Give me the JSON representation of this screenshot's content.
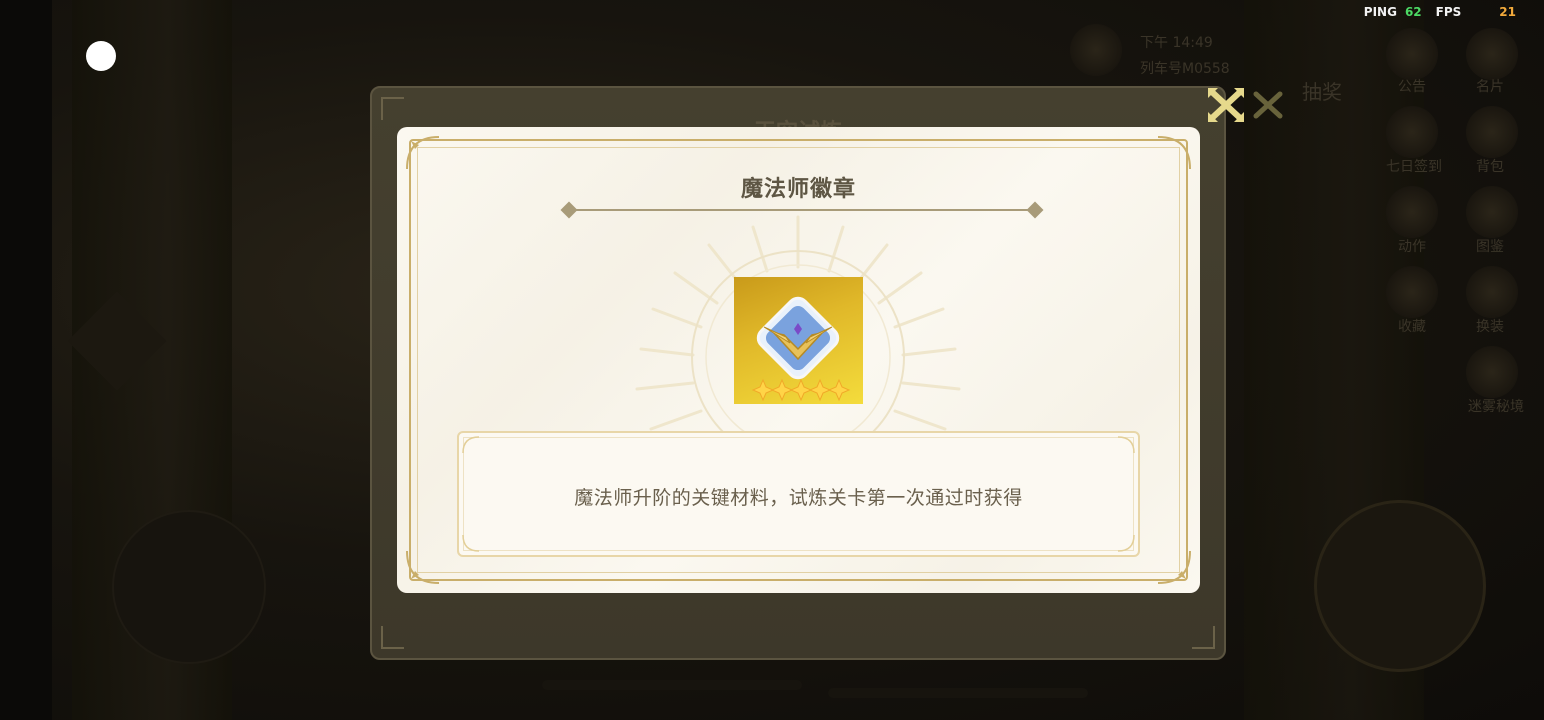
{
  "status_bar": {
    "ping_label": "PING",
    "ping_value": "62",
    "fps_label": "FPS",
    "fps_value": "21",
    "ping_color": "#4cd964",
    "fps_color": "#f2a93b"
  },
  "background": {
    "time_text": "下午 14:49",
    "sub_text": "列车号M0558",
    "lottery_label": "抽奖",
    "side_menu": [
      "公告",
      "名片",
      "七日签到",
      "背包",
      "动作",
      "图鉴",
      "收藏",
      "换装",
      "迷雾秘境"
    ]
  },
  "outer_panel": {
    "title": "天空试炼"
  },
  "dialog": {
    "title": "魔法师徽章",
    "description": "魔法师升阶的关键材料，试炼关卡第一次通过时获得",
    "item_icon": "mage-badge-icon",
    "item_stars": 5,
    "close_icon": "close-x-icon",
    "accent_color": "#c9ae6a"
  }
}
